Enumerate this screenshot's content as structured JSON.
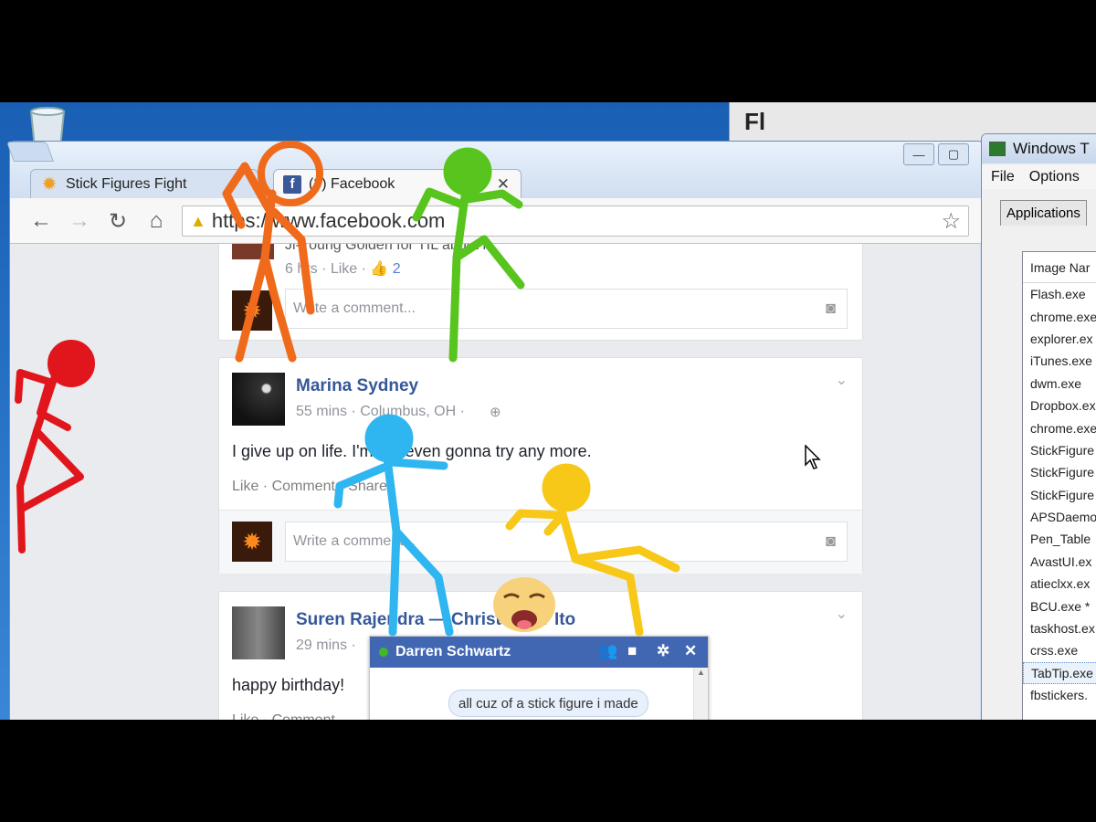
{
  "browser": {
    "tabs": [
      {
        "label": "Stick Figures Fight",
        "icon": "sun-icon"
      },
      {
        "label": "(3) Facebook",
        "icon": "facebook-icon"
      }
    ],
    "url": "https://www.facebook.com"
  },
  "flash_window": {
    "title": "Fl"
  },
  "posts": [
    {
      "partial_header": "Ji-Young Golden for TIL about it",
      "time": "6 hrs",
      "like_label": "Like",
      "like_count": "2",
      "comment_placeholder": "Write a comment..."
    },
    {
      "author": "Marina Sydney",
      "meta": "55 mins · Columbus, OH · ",
      "text": "I give up on life. I'm not even gonna try any more.",
      "actions": "Like · Comment · Share",
      "comment_placeholder": "Write a comment..."
    },
    {
      "author": "Suren Rajendra — Christopher Ito",
      "meta": "29 mins ·",
      "text": "happy birthday!",
      "actions": "Like · Comment"
    }
  ],
  "chat": {
    "contact": "Darren Schwartz",
    "message": "all cuz of a stick figure i made"
  },
  "task_manager": {
    "title": "Windows T",
    "menu": [
      "File",
      "Options"
    ],
    "tab": "Applications",
    "column_header": "Image Nar",
    "processes": [
      "Flash.exe",
      "chrome.exe",
      "explorer.ex",
      "iTunes.exe",
      "dwm.exe",
      "Dropbox.ex",
      "chrome.exe",
      "StickFigure",
      "StickFigure",
      "StickFigure",
      "APSDaemo",
      "Pen_Table",
      "AvastUI.ex",
      "atieclxx.ex",
      "BCU.exe *",
      "taskhost.ex",
      "crss.exe",
      "TabTip.exe",
      "fbstickers."
    ],
    "selected_process": "TabTip.exe"
  },
  "colors": {
    "facebook_blue": "#3b5998",
    "chat_header": "#4267b2",
    "desktop_blue": "#2a76c9",
    "red_figure": "#e0161c",
    "orange_figure": "#f06a1c",
    "green_figure": "#58c41e",
    "blue_figure": "#2fb6f0",
    "yellow_figure": "#f8c818"
  }
}
